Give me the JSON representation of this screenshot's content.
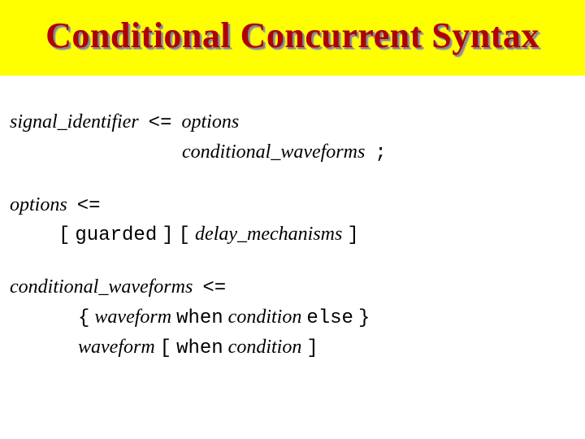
{
  "title": "Conditional Concurrent Syntax",
  "rule1": {
    "lhs": "signal_identifier",
    "op": "<=",
    "rhs_a": "options",
    "rhs_b": "conditional_waveforms",
    "term": ";"
  },
  "rule2": {
    "lhs": "options",
    "op": "<=",
    "lb1": "[",
    "kw1": "guarded",
    "rb1": "]",
    "lb2": "[",
    "mid": "delay_mechanisms",
    "rb2": "]"
  },
  "rule3": {
    "lhs": "conditional_waveforms",
    "op": "<=",
    "lb": "{",
    "wf1": "waveform",
    "when1": "when",
    "cond1": "condition",
    "else": "else",
    "rb": "}",
    "wf2": "waveform",
    "lb2": "[",
    "when2": "when",
    "cond2": "condition",
    "rb2": "]"
  }
}
